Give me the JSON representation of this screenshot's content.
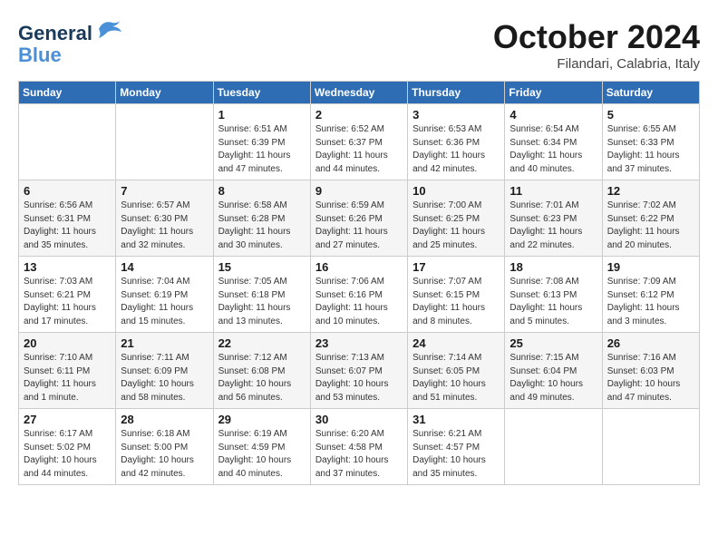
{
  "header": {
    "logo_line1": "General",
    "logo_line2": "Blue",
    "month": "October 2024",
    "location": "Filandari, Calabria, Italy"
  },
  "weekdays": [
    "Sunday",
    "Monday",
    "Tuesday",
    "Wednesday",
    "Thursday",
    "Friday",
    "Saturday"
  ],
  "weeks": [
    [
      {
        "day": "",
        "info": ""
      },
      {
        "day": "",
        "info": ""
      },
      {
        "day": "1",
        "info": "Sunrise: 6:51 AM\nSunset: 6:39 PM\nDaylight: 11 hours and 47 minutes."
      },
      {
        "day": "2",
        "info": "Sunrise: 6:52 AM\nSunset: 6:37 PM\nDaylight: 11 hours and 44 minutes."
      },
      {
        "day": "3",
        "info": "Sunrise: 6:53 AM\nSunset: 6:36 PM\nDaylight: 11 hours and 42 minutes."
      },
      {
        "day": "4",
        "info": "Sunrise: 6:54 AM\nSunset: 6:34 PM\nDaylight: 11 hours and 40 minutes."
      },
      {
        "day": "5",
        "info": "Sunrise: 6:55 AM\nSunset: 6:33 PM\nDaylight: 11 hours and 37 minutes."
      }
    ],
    [
      {
        "day": "6",
        "info": "Sunrise: 6:56 AM\nSunset: 6:31 PM\nDaylight: 11 hours and 35 minutes."
      },
      {
        "day": "7",
        "info": "Sunrise: 6:57 AM\nSunset: 6:30 PM\nDaylight: 11 hours and 32 minutes."
      },
      {
        "day": "8",
        "info": "Sunrise: 6:58 AM\nSunset: 6:28 PM\nDaylight: 11 hours and 30 minutes."
      },
      {
        "day": "9",
        "info": "Sunrise: 6:59 AM\nSunset: 6:26 PM\nDaylight: 11 hours and 27 minutes."
      },
      {
        "day": "10",
        "info": "Sunrise: 7:00 AM\nSunset: 6:25 PM\nDaylight: 11 hours and 25 minutes."
      },
      {
        "day": "11",
        "info": "Sunrise: 7:01 AM\nSunset: 6:23 PM\nDaylight: 11 hours and 22 minutes."
      },
      {
        "day": "12",
        "info": "Sunrise: 7:02 AM\nSunset: 6:22 PM\nDaylight: 11 hours and 20 minutes."
      }
    ],
    [
      {
        "day": "13",
        "info": "Sunrise: 7:03 AM\nSunset: 6:21 PM\nDaylight: 11 hours and 17 minutes."
      },
      {
        "day": "14",
        "info": "Sunrise: 7:04 AM\nSunset: 6:19 PM\nDaylight: 11 hours and 15 minutes."
      },
      {
        "day": "15",
        "info": "Sunrise: 7:05 AM\nSunset: 6:18 PM\nDaylight: 11 hours and 13 minutes."
      },
      {
        "day": "16",
        "info": "Sunrise: 7:06 AM\nSunset: 6:16 PM\nDaylight: 11 hours and 10 minutes."
      },
      {
        "day": "17",
        "info": "Sunrise: 7:07 AM\nSunset: 6:15 PM\nDaylight: 11 hours and 8 minutes."
      },
      {
        "day": "18",
        "info": "Sunrise: 7:08 AM\nSunset: 6:13 PM\nDaylight: 11 hours and 5 minutes."
      },
      {
        "day": "19",
        "info": "Sunrise: 7:09 AM\nSunset: 6:12 PM\nDaylight: 11 hours and 3 minutes."
      }
    ],
    [
      {
        "day": "20",
        "info": "Sunrise: 7:10 AM\nSunset: 6:11 PM\nDaylight: 11 hours and 1 minute."
      },
      {
        "day": "21",
        "info": "Sunrise: 7:11 AM\nSunset: 6:09 PM\nDaylight: 10 hours and 58 minutes."
      },
      {
        "day": "22",
        "info": "Sunrise: 7:12 AM\nSunset: 6:08 PM\nDaylight: 10 hours and 56 minutes."
      },
      {
        "day": "23",
        "info": "Sunrise: 7:13 AM\nSunset: 6:07 PM\nDaylight: 10 hours and 53 minutes."
      },
      {
        "day": "24",
        "info": "Sunrise: 7:14 AM\nSunset: 6:05 PM\nDaylight: 10 hours and 51 minutes."
      },
      {
        "day": "25",
        "info": "Sunrise: 7:15 AM\nSunset: 6:04 PM\nDaylight: 10 hours and 49 minutes."
      },
      {
        "day": "26",
        "info": "Sunrise: 7:16 AM\nSunset: 6:03 PM\nDaylight: 10 hours and 47 minutes."
      }
    ],
    [
      {
        "day": "27",
        "info": "Sunrise: 6:17 AM\nSunset: 5:02 PM\nDaylight: 10 hours and 44 minutes."
      },
      {
        "day": "28",
        "info": "Sunrise: 6:18 AM\nSunset: 5:00 PM\nDaylight: 10 hours and 42 minutes."
      },
      {
        "day": "29",
        "info": "Sunrise: 6:19 AM\nSunset: 4:59 PM\nDaylight: 10 hours and 40 minutes."
      },
      {
        "day": "30",
        "info": "Sunrise: 6:20 AM\nSunset: 4:58 PM\nDaylight: 10 hours and 37 minutes."
      },
      {
        "day": "31",
        "info": "Sunrise: 6:21 AM\nSunset: 4:57 PM\nDaylight: 10 hours and 35 minutes."
      },
      {
        "day": "",
        "info": ""
      },
      {
        "day": "",
        "info": ""
      }
    ]
  ]
}
